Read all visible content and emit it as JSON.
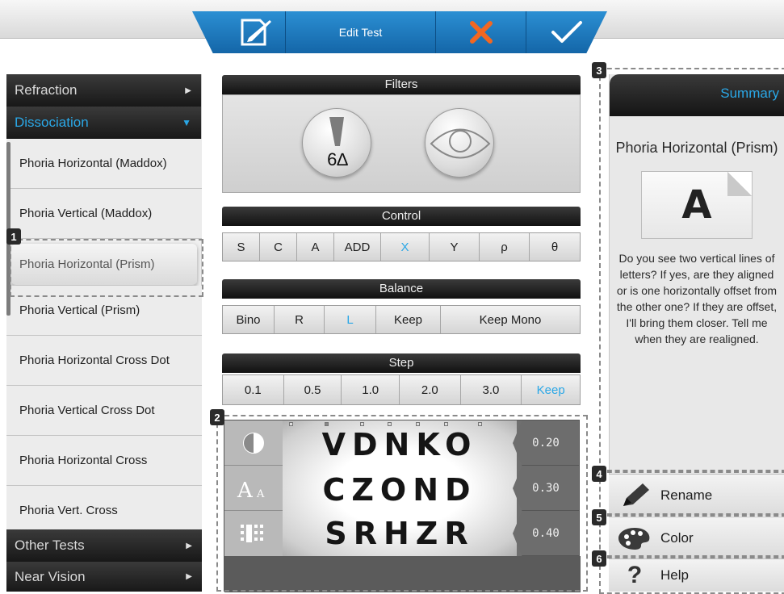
{
  "topbar": {
    "title": "Edit Test"
  },
  "sidebar": {
    "categories_top": [
      {
        "label": "Refraction",
        "arrow": "▶"
      },
      {
        "label": "Dissociation",
        "arrow": "▼"
      }
    ],
    "tests": [
      "Phoria Horizontal (Maddox)",
      "Phoria Vertical (Maddox)",
      "Phoria Horizontal (Prism)",
      "Phoria Vertical (Prism)",
      "Phoria Horizontal Cross Dot",
      "Phoria Vertical Cross Dot",
      "Phoria Horizontal Cross",
      "Phoria Vert. Cross"
    ],
    "selected_index": 2,
    "categories_bottom": [
      {
        "label": "Other Tests",
        "arrow": "▶"
      },
      {
        "label": "Near Vision",
        "arrow": "▶"
      }
    ]
  },
  "filters": {
    "title": "Filters",
    "prism_value": "6∆"
  },
  "control": {
    "title": "Control",
    "buttons": [
      "S",
      "C",
      "A",
      "ADD",
      "X",
      "Y",
      "ρ",
      "θ"
    ],
    "active": "X"
  },
  "balance": {
    "title": "Balance",
    "buttons": [
      "Bino",
      "R",
      "L",
      "Keep",
      "Keep Mono"
    ],
    "active": "L"
  },
  "step": {
    "title": "Step",
    "buttons": [
      "0.1",
      "0.5",
      "1.0",
      "2.0",
      "3.0",
      "Keep"
    ],
    "active": "Keep"
  },
  "chart": {
    "rows": [
      "VDNKO",
      "CZOND",
      "SRHZR"
    ],
    "acuity": [
      "0.20",
      "0.30",
      "0.40"
    ],
    "tool_labels": [
      "contrast-icon",
      "font-size-icon",
      "grid-icon"
    ]
  },
  "summary": {
    "header": "Summary",
    "title": "Phoria Horizontal (Prism)",
    "letter": "A",
    "text": "Do you see two vertical lines of letters? If yes, are they aligned or is one horizontally offset from the other one? If they are offset, I'll bring them closer. Tell me when they are realigned."
  },
  "actions": {
    "rename": "Rename",
    "color": "Color",
    "help": "Help"
  },
  "callouts": [
    "1",
    "2",
    "3",
    "4",
    "5",
    "6"
  ],
  "colors": {
    "accent": "#2aa7e6",
    "cancel": "#f26722",
    "topbar": "#1f7cc0"
  }
}
